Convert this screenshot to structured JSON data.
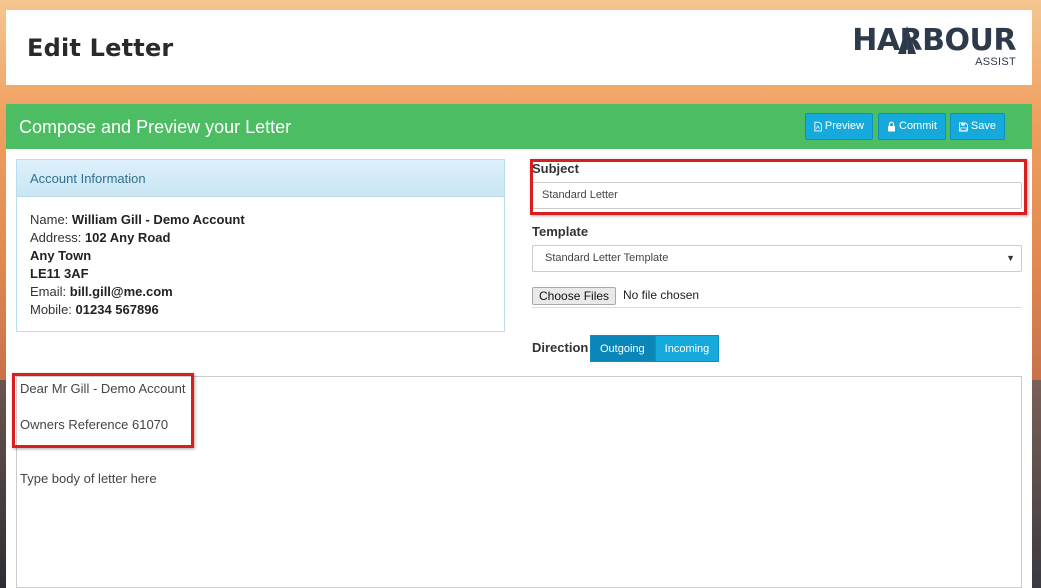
{
  "header": {
    "title": "Edit Letter",
    "logo_word": "HARBOUR",
    "logo_sub": "ASSIST"
  },
  "panel": {
    "title": "Compose and Preview your Letter",
    "buttons": {
      "preview": "Preview",
      "commit": "Commit",
      "save": "Save"
    }
  },
  "account": {
    "heading": "Account Information",
    "name_label": "Name:",
    "name_value": "William Gill - Demo Account",
    "address_label": "Address:",
    "address_line1": "102 Any Road",
    "address_line2": "Any Town",
    "address_line3": "LE11 3AF",
    "email_label": "Email:",
    "email_value": "bill.gill@me.com",
    "mobile_label": "Mobile:",
    "mobile_value": "01234 567896"
  },
  "form": {
    "subject_label": "Subject",
    "subject_value": "Standard Letter",
    "template_label": "Template",
    "template_value": "Standard Letter Template",
    "file_button": "Choose Files",
    "file_status": "No file chosen",
    "direction_label": "Direction",
    "direction_options": [
      "Outgoing",
      "Incoming"
    ],
    "direction_selected": "Outgoing"
  },
  "editor": {
    "line1": "Dear Mr Gill - Demo Account",
    "line2": "Owners Reference 61070",
    "line3": "Type body of letter here"
  },
  "colors": {
    "header_bar": "#4cbd63",
    "button": "#16a9dc",
    "button_active": "#0b86b8",
    "highlight": "#d81e1e"
  }
}
